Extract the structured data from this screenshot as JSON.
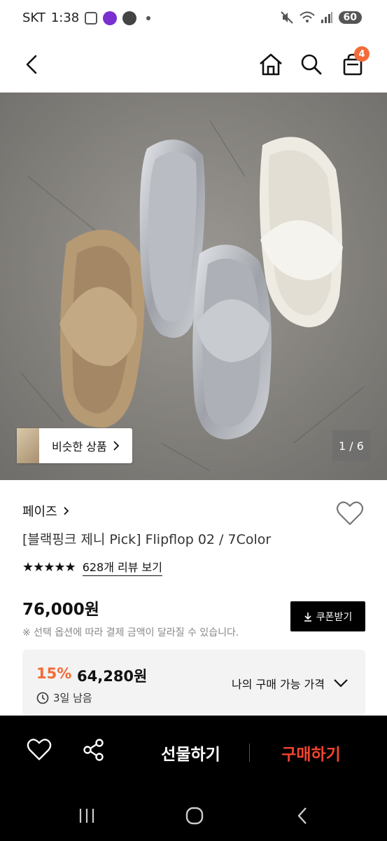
{
  "status_bar": {
    "carrier": "SKT",
    "time": "1:38",
    "battery": "60"
  },
  "header": {
    "cart_count": "4"
  },
  "gallery": {
    "similar_label": "비슷한 상품",
    "pager": "1 / 6"
  },
  "product": {
    "brand": "페이즈",
    "name": "[블랙핑크 제니 Pick] Flipflop 02 / 7Color",
    "rating": 4.5,
    "stars": "★★★★★",
    "review_link": "628개 리뷰 보기",
    "price": "76,000원",
    "coupon_label": "쿠폰받기",
    "notice": "※ 선택 옵션에 따라 결제 금액이 달라질 수 있습니다."
  },
  "discount": {
    "percent": "15%",
    "price": "64,280원",
    "remaining": "3일 남음",
    "toggle_label": "나의 구매 가능 가격"
  },
  "actions": {
    "gift_label": "선물하기",
    "buy_label": "구매하기"
  },
  "colors": {
    "accent_orange": "#f26b38",
    "buy_red": "#f2442e"
  }
}
